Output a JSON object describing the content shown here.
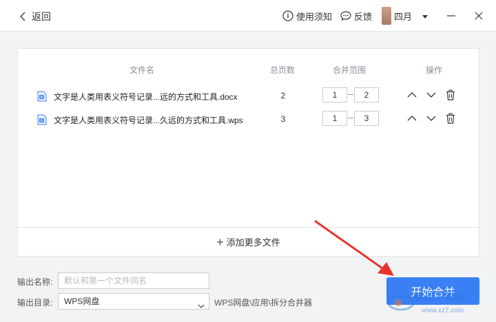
{
  "titlebar": {
    "back_label": "返回",
    "notice_label": "使用须知",
    "feedback_label": "反馈",
    "user_name": "四月"
  },
  "table": {
    "headers": {
      "file_name": "文件名",
      "total_pages": "总页数",
      "merge_range": "合并范围",
      "actions": "操作"
    },
    "rows": [
      {
        "file_name": "文字是人类用表义符号记录...远的方式和工具.docx",
        "pages": "2",
        "range_from": "1",
        "range_to": "2"
      },
      {
        "file_name": "文字是人类用表义符号记录...久远的方式和工具.wps",
        "pages": "3",
        "range_from": "1",
        "range_to": "3"
      }
    ]
  },
  "add_more_label": "添加更多文件",
  "output": {
    "name_label": "输出名称:",
    "name_placeholder": "默认和第一个文件同名",
    "dir_label": "输出目录:",
    "dir_value": "WPS网盘",
    "dir_path": "WPS网盘\\应用\\拆分合并器"
  },
  "start_button": "开始合并",
  "watermark": {
    "text": "极光下载站",
    "url": "www.xz7.com"
  },
  "colors": {
    "primary": "#3b7ff5",
    "arrow": "#e8332a"
  }
}
